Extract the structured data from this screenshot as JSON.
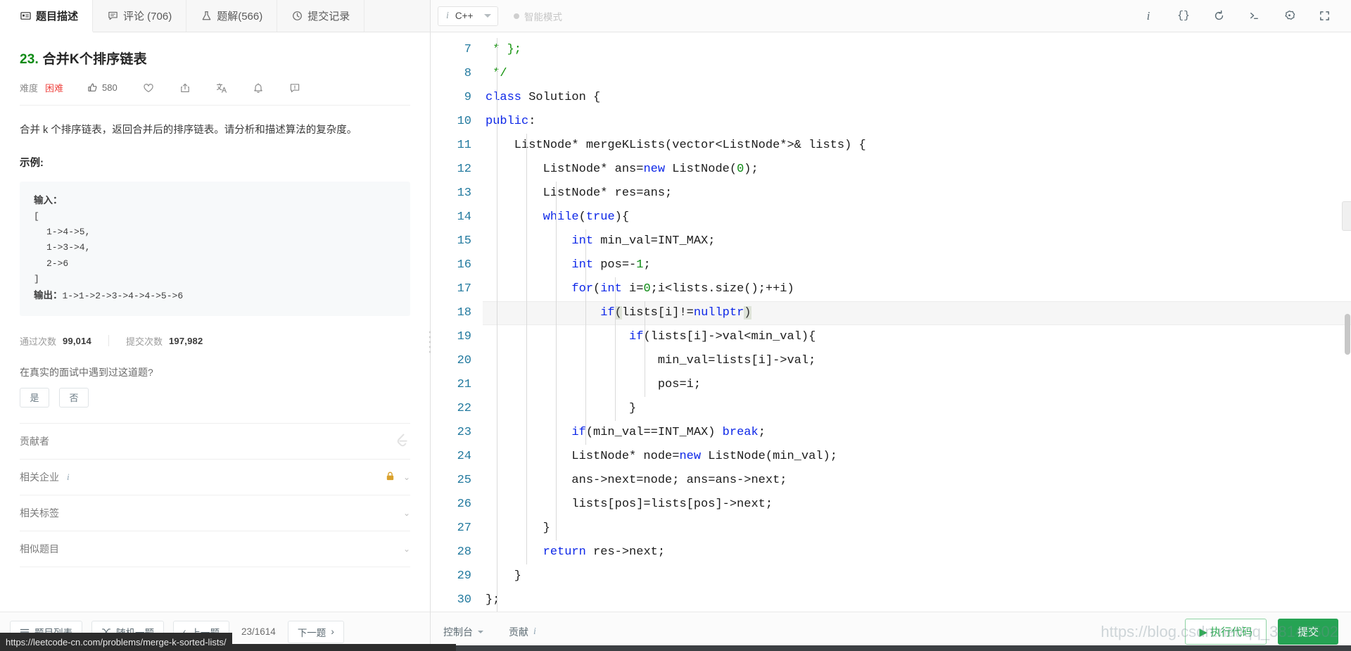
{
  "tabs": [
    {
      "id": "description",
      "label": "题目描述",
      "icon": "description-icon",
      "active": true
    },
    {
      "id": "comments",
      "label": "评论 (706)",
      "icon": "comment-icon",
      "active": false
    },
    {
      "id": "solutions",
      "label": "题解(566)",
      "icon": "flask-icon",
      "active": false
    },
    {
      "id": "submissions",
      "label": "提交记录",
      "icon": "clock-icon",
      "active": false
    }
  ],
  "editor_toolbar": {
    "language": "C++",
    "language_info_icon": "i",
    "smart_mode_label": "智能模式",
    "icons": [
      {
        "id": "info",
        "name": "info-icon",
        "glyph": "i"
      },
      {
        "id": "format",
        "name": "format-braces-icon",
        "glyph": "{}"
      },
      {
        "id": "reset",
        "name": "reset-icon",
        "glyph": "↺"
      },
      {
        "id": "console",
        "name": "terminal-icon",
        "glyph": ">_"
      },
      {
        "id": "settings",
        "name": "gear-icon",
        "glyph": "⚙"
      },
      {
        "id": "fullscreen",
        "name": "fullscreen-icon",
        "glyph": "⛶"
      }
    ]
  },
  "problem": {
    "number": "23.",
    "title": "合并K个排序链表",
    "difficulty_label": "难度",
    "difficulty_value": "困难",
    "difficulty_color": "#ef4743",
    "likes": "580",
    "description": "合并 k 个排序链表，返回合并后的排序链表。请分析和描述算法的复杂度。",
    "description_italic_var": "k",
    "example_heading": "示例:",
    "example": {
      "input_label": "输入：",
      "input_lines": [
        "[",
        "1->4->5,",
        "1->3->4,",
        "2->6",
        "]"
      ],
      "output_label": "输出：",
      "output_value": "1->1->2->3->4->4->5->6"
    },
    "stats": {
      "accepted_label": "通过次数",
      "accepted_value": "99,014",
      "submissions_label": "提交次数",
      "submissions_value": "197,982"
    },
    "interview_question": "在真实的面试中遇到过这道题?",
    "yes_label": "是",
    "no_label": "否",
    "sections": [
      {
        "id": "contributors",
        "label": "贡献者",
        "icon": "leetcode-logo-icon",
        "has_chevron": false,
        "locked": false
      },
      {
        "id": "companies",
        "label": "相关企业",
        "info": "i",
        "icon": "lock-icon",
        "has_chevron": true,
        "locked": true
      },
      {
        "id": "tags",
        "label": "相关标签",
        "has_chevron": true,
        "locked": false
      },
      {
        "id": "similar",
        "label": "相似题目",
        "has_chevron": true,
        "locked": false
      }
    ]
  },
  "left_bottom": {
    "list_label": "题目列表",
    "random_label": "随机一题",
    "prev_label": "上一题",
    "page_indicator": "23/1614",
    "next_label": "下一题"
  },
  "editor_bottom": {
    "console_label": "控制台",
    "contribute_label": "贡献",
    "contribute_info": "i",
    "run_label": "执行代码",
    "run_icon": "▶",
    "submit_label": "提交"
  },
  "status_url": "https://leetcode-cn.com/problems/merge-k-sorted-lists/",
  "watermark": "https://blog.csdn.net/qq_38145502",
  "code": {
    "first_line_number": 7,
    "active_line": 18,
    "lines": [
      {
        "n": 7,
        "tokens": [
          {
            "t": " * };",
            "c": "cmt"
          }
        ]
      },
      {
        "n": 8,
        "tokens": [
          {
            "t": " */",
            "c": "cmt"
          }
        ]
      },
      {
        "n": 9,
        "tokens": [
          {
            "t": "class",
            "c": "kw"
          },
          {
            "t": " Solution {",
            "c": "plain"
          }
        ]
      },
      {
        "n": 10,
        "tokens": [
          {
            "t": "public",
            "c": "kw"
          },
          {
            "t": ":",
            "c": "plain"
          }
        ]
      },
      {
        "n": 11,
        "tokens": [
          {
            "t": "    ListNode* mergeKLists(vector<ListNode*>& lists) {",
            "c": "plain"
          }
        ]
      },
      {
        "n": 12,
        "tokens": [
          {
            "t": "        ListNode* ans=",
            "c": "plain"
          },
          {
            "t": "new",
            "c": "kw"
          },
          {
            "t": " ListNode(",
            "c": "plain"
          },
          {
            "t": "0",
            "c": "num"
          },
          {
            "t": ");",
            "c": "plain"
          }
        ]
      },
      {
        "n": 13,
        "tokens": [
          {
            "t": "        ListNode* res=ans;",
            "c": "plain"
          }
        ]
      },
      {
        "n": 14,
        "tokens": [
          {
            "t": "        ",
            "c": "plain"
          },
          {
            "t": "while",
            "c": "kw"
          },
          {
            "t": "(",
            "c": "plain"
          },
          {
            "t": "true",
            "c": "kw"
          },
          {
            "t": "){",
            "c": "plain"
          }
        ]
      },
      {
        "n": 15,
        "tokens": [
          {
            "t": "            ",
            "c": "plain"
          },
          {
            "t": "int",
            "c": "kw"
          },
          {
            "t": " min_val=INT_MAX;",
            "c": "plain"
          }
        ]
      },
      {
        "n": 16,
        "tokens": [
          {
            "t": "            ",
            "c": "plain"
          },
          {
            "t": "int",
            "c": "kw"
          },
          {
            "t": " pos=-",
            "c": "plain"
          },
          {
            "t": "1",
            "c": "num"
          },
          {
            "t": ";",
            "c": "plain"
          }
        ]
      },
      {
        "n": 17,
        "tokens": [
          {
            "t": "            ",
            "c": "plain"
          },
          {
            "t": "for",
            "c": "kw"
          },
          {
            "t": "(",
            "c": "plain"
          },
          {
            "t": "int",
            "c": "kw"
          },
          {
            "t": " i=",
            "c": "plain"
          },
          {
            "t": "0",
            "c": "num"
          },
          {
            "t": ";i<lists.size();++i)",
            "c": "plain"
          }
        ]
      },
      {
        "n": 18,
        "tokens": [
          {
            "t": "                ",
            "c": "plain"
          },
          {
            "t": "if",
            "c": "kw"
          },
          {
            "t": "(",
            "c": "brk"
          },
          {
            "t": "lists[i]!=",
            "c": "plain"
          },
          {
            "t": "nullptr",
            "c": "kw"
          },
          {
            "t": ")",
            "c": "brk"
          }
        ]
      },
      {
        "n": 19,
        "tokens": [
          {
            "t": "                    ",
            "c": "plain"
          },
          {
            "t": "if",
            "c": "kw"
          },
          {
            "t": "(lists[i]->val<min_val){",
            "c": "plain"
          }
        ]
      },
      {
        "n": 20,
        "tokens": [
          {
            "t": "                        min_val=lists[i]->val;",
            "c": "plain"
          }
        ]
      },
      {
        "n": 21,
        "tokens": [
          {
            "t": "                        pos=i;",
            "c": "plain"
          }
        ]
      },
      {
        "n": 22,
        "tokens": [
          {
            "t": "                    }",
            "c": "plain"
          }
        ]
      },
      {
        "n": 23,
        "tokens": [
          {
            "t": "            ",
            "c": "plain"
          },
          {
            "t": "if",
            "c": "kw"
          },
          {
            "t": "(min_val==INT_MAX) ",
            "c": "plain"
          },
          {
            "t": "break",
            "c": "kw"
          },
          {
            "t": ";",
            "c": "plain"
          }
        ]
      },
      {
        "n": 24,
        "tokens": [
          {
            "t": "            ListNode* node=",
            "c": "plain"
          },
          {
            "t": "new",
            "c": "kw"
          },
          {
            "t": " ListNode(min_val);",
            "c": "plain"
          }
        ]
      },
      {
        "n": 25,
        "tokens": [
          {
            "t": "            ans->next=node; ans=ans->next;",
            "c": "plain"
          }
        ]
      },
      {
        "n": 26,
        "tokens": [
          {
            "t": "            lists[pos]=lists[pos]->next;",
            "c": "plain"
          }
        ]
      },
      {
        "n": 27,
        "tokens": [
          {
            "t": "        }",
            "c": "plain"
          }
        ]
      },
      {
        "n": 28,
        "tokens": [
          {
            "t": "        ",
            "c": "plain"
          },
          {
            "t": "return",
            "c": "kw"
          },
          {
            "t": " res->next;",
            "c": "plain"
          }
        ]
      },
      {
        "n": 29,
        "tokens": [
          {
            "t": "    }",
            "c": "plain"
          }
        ]
      },
      {
        "n": 30,
        "tokens": [
          {
            "t": "};",
            "c": "plain"
          }
        ]
      }
    ]
  }
}
